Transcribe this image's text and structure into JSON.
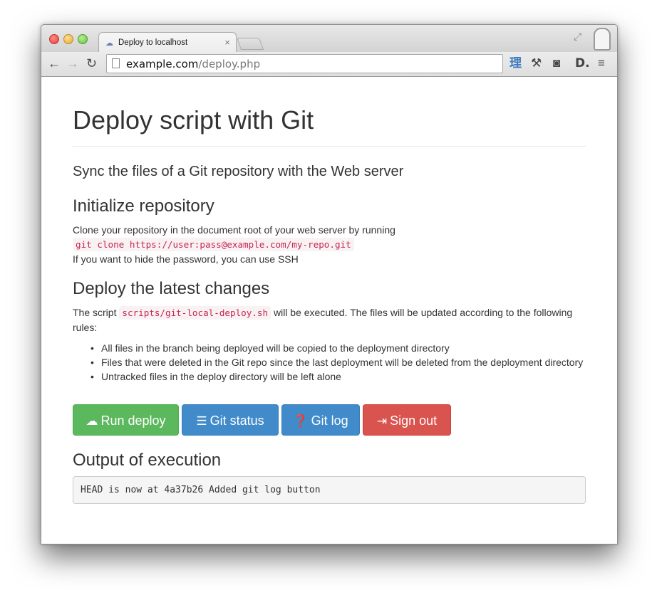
{
  "browser": {
    "tab_title": "Deploy to localhost",
    "tab_close": "×",
    "url_host": "example.com",
    "url_path": "/deploy.php",
    "extensions": {
      "kanji": "理",
      "wrench": "⚒",
      "pocket": "◙",
      "dlogo": "D.",
      "menu": "≡"
    }
  },
  "page": {
    "title": "Deploy script with Git",
    "lead": "Sync the files of a Git repository with the Web server",
    "init": {
      "heading": "Initialize repository",
      "line1": "Clone your repository in the document root of your web server by running",
      "command": "git clone https://user:pass@example.com/my-repo.git",
      "line2": "If you want to hide the password, you can use SSH"
    },
    "deploy": {
      "heading": "Deploy the latest changes",
      "text_before": "The script ",
      "script": "scripts/git-local-deploy.sh",
      "text_after": " will be executed. The files will be updated according to the following rules:",
      "rules": [
        "All files in the branch being deployed will be copied to the deployment directory",
        "Files that were deleted in the Git repo since the last deployment will be deleted from the deployment directory",
        "Untracked files in the deploy directory will be left alone"
      ]
    },
    "buttons": {
      "run_deploy": "Run deploy",
      "git_status": "Git status",
      "git_log": "Git log",
      "sign_out": "Sign out"
    },
    "output": {
      "heading": "Output of execution",
      "text": "HEAD is now at 4a37b26 Added git log button"
    }
  },
  "colors": {
    "success": "#5cb85c",
    "info": "#428bca",
    "danger": "#d9534f",
    "code": "#c7254e"
  }
}
